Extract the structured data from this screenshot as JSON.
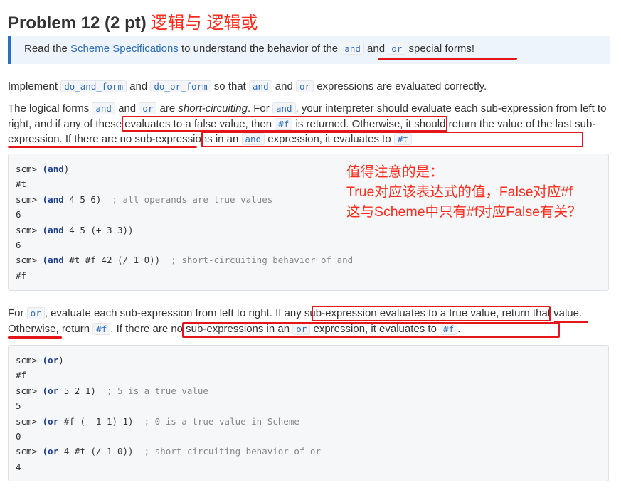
{
  "header": {
    "title": "Problem 12 (2 pt)",
    "annotation": "逻辑与 逻辑或"
  },
  "note": {
    "before": "Read the ",
    "link": "Scheme Specifications",
    "middle": " to understand the behavior of the ",
    "code_and": "and",
    "and_word": " and ",
    "code_or": "or",
    "after": " special forms!"
  },
  "p1": {
    "t1": "Implement ",
    "c1": "do_and_form",
    "t2": " and ",
    "c2": "do_or_form",
    "t3": " so that ",
    "c3": "and",
    "t4": " and ",
    "c4": "or",
    "t5": " expressions are evaluated correctly."
  },
  "p2": {
    "t1": "The logical forms ",
    "c1": "and",
    "t2": " and ",
    "c2": "or",
    "t3": " are ",
    "em": "short-circuiting",
    "t4": ". For ",
    "c3": "and",
    "t5": ", your interpreter should evaluate each sub-expression from left to right, and if any of these evaluates to a false value, then ",
    "c4": "#f",
    "t6": " is returned. Otherwise, it should return the value of the last sub-expression. If there are no sub-expressions in an ",
    "c5": "and",
    "t7": " expression, it evaluates to ",
    "c6": "#t"
  },
  "code1": [
    {
      "prompt": "scm> ",
      "expr_kw": "(and",
      "expr_rest": ")",
      "comment": ""
    },
    {
      "out": "#t"
    },
    {
      "prompt": "scm> ",
      "expr_kw": "(and",
      "expr_rest": " 4 5 6)",
      "comment": "  ; all operands are true values"
    },
    {
      "out": "6"
    },
    {
      "prompt": "scm> ",
      "expr_kw": "(and",
      "expr_rest": " 4 5 (+ 3 3))",
      "comment": ""
    },
    {
      "out": "6"
    },
    {
      "prompt": "scm> ",
      "expr_kw": "(and",
      "expr_rest": " #t #f 42 (/ 1 0))",
      "comment": "  ; short-circuiting behavior of and"
    },
    {
      "out": "#f"
    }
  ],
  "annotation": {
    "line1": "值得注意的是：",
    "line2": "True对应该表达式的值，False对应#f",
    "line3": "这与Scheme中只有#f对应False有关？"
  },
  "p3": {
    "t1": "For ",
    "c1": "or",
    "t2": ", evaluate each sub-expression from left to right. If any sub-expression evaluates to a true value, return that value. Otherwise, return ",
    "c2": "#f",
    "t3": ". If there are no sub-expressions in an ",
    "c3": "or",
    "t4": " expression, it evaluates to ",
    "c4": "#f",
    "t5": "."
  },
  "code2": [
    {
      "prompt": "scm> ",
      "expr_kw": "(or",
      "expr_rest": ")",
      "comment": ""
    },
    {
      "out": "#f"
    },
    {
      "prompt": "scm> ",
      "expr_kw": "(or",
      "expr_rest": " 5 2 1)",
      "comment": "  ; 5 is a true value"
    },
    {
      "out": "5"
    },
    {
      "prompt": "scm> ",
      "expr_kw": "(or",
      "expr_rest": " #f (- 1 1) 1)",
      "comment": "  ; 0 is a true value in Scheme"
    },
    {
      "out": "0"
    },
    {
      "prompt": "scm> ",
      "expr_kw": "(or",
      "expr_rest": " 4 #t (/ 1 0))",
      "comment": "  ; short-circuiting behavior of or"
    },
    {
      "out": "4"
    }
  ]
}
